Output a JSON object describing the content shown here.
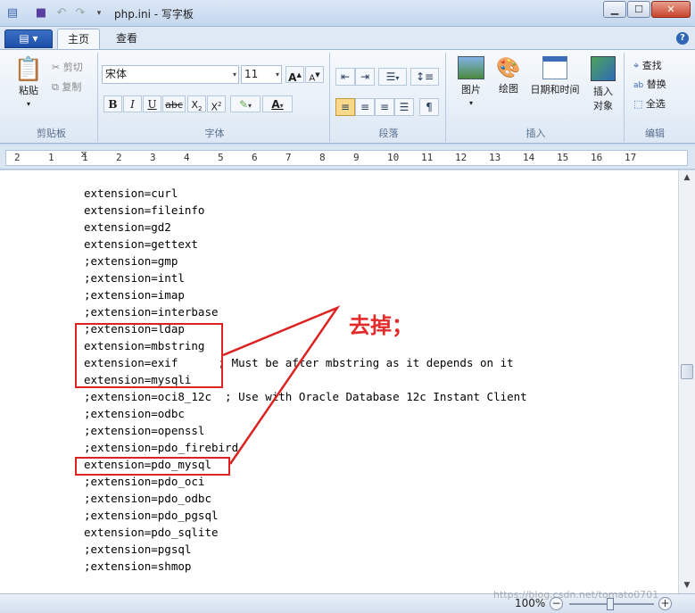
{
  "window": {
    "title": "php.ini - 写字板",
    "minimize": "▁",
    "maximize": "☐",
    "close": "✕"
  },
  "tabs": {
    "file_menu": "▤ ▾",
    "home": "主页",
    "view": "查看",
    "help": "?"
  },
  "ribbon": {
    "clipboard": {
      "label": "剪贴板",
      "paste": "粘贴",
      "cut": "剪切",
      "copy": "复制"
    },
    "font": {
      "label": "字体",
      "family": "宋体",
      "size": "11"
    },
    "paragraph": {
      "label": "段落"
    },
    "insert": {
      "label": "插入",
      "picture": "图片",
      "paint": "绘图",
      "datetime": "日期和时间",
      "object_line1": "插入",
      "object_line2": "对象"
    },
    "edit": {
      "label": "编辑",
      "find": "查找",
      "replace": "替换",
      "select_all": "全选"
    }
  },
  "ruler": {
    "ticks": [
      "2",
      "1",
      "1",
      "2",
      "3",
      "4",
      "5",
      "6",
      "7",
      "8",
      "9",
      "10",
      "11",
      "12",
      "13",
      "14",
      "15",
      "16",
      "17"
    ]
  },
  "document": {
    "lines": [
      "extension=curl",
      "extension=fileinfo",
      "extension=gd2",
      "extension=gettext",
      ";extension=gmp",
      ";extension=intl",
      ";extension=imap",
      ";extension=interbase",
      ";extension=ldap",
      "extension=mbstring",
      "extension=exif      ; Must be after mbstring as it depends on it",
      "extension=mysqli",
      ";extension=oci8_12c  ; Use with Oracle Database 12c Instant Client",
      ";extension=odbc",
      ";extension=openssl",
      ";extension=pdo_firebird",
      "extension=pdo_mysql",
      ";extension=pdo_oci",
      ";extension=pdo_odbc",
      ";extension=pdo_pgsql",
      "extension=pdo_sqlite",
      ";extension=pgsql",
      ";extension=shmop"
    ]
  },
  "annotation": {
    "text": "去掉；",
    "color": "#e32b2b"
  },
  "status": {
    "zoom": "100%"
  },
  "watermark": "https://blog.csdn.net/tomato0701"
}
